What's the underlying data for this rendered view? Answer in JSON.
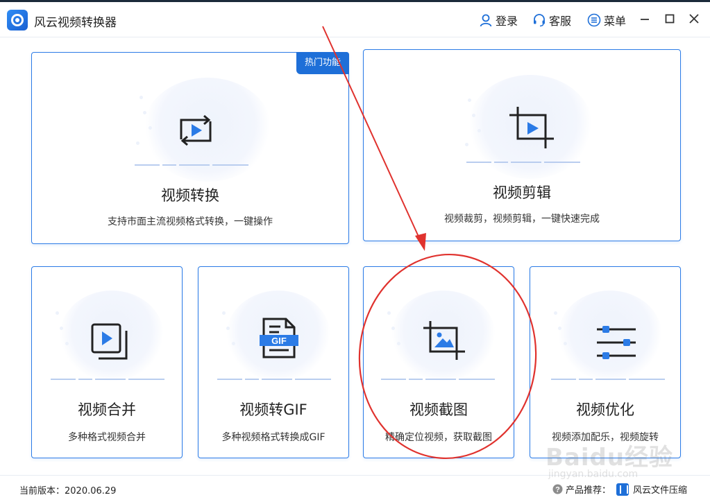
{
  "window": {
    "title": "风云视频转换器"
  },
  "toolbar": {
    "login_label": "登录",
    "service_label": "客服",
    "menu_label": "菜单"
  },
  "cards": {
    "convert": {
      "title": "视频转换",
      "desc": "支持市面主流视频格式转换，一键操作",
      "badge": "热门功能"
    },
    "edit": {
      "title": "视频剪辑",
      "desc": "视频裁剪，视频剪辑，一键快速完成"
    },
    "merge": {
      "title": "视频合并",
      "desc": "多种格式视频合并"
    },
    "gif": {
      "title": "视频转GIF",
      "desc": "多种视频格式转换成GIF",
      "icon_text": "GIF"
    },
    "screenshot": {
      "title": "视频截图",
      "desc": "精确定位视频，获取截图"
    },
    "optimize": {
      "title": "视频优化",
      "desc": "视频添加配乐，视频旋转"
    }
  },
  "status": {
    "version_label": "当前版本：2020.06.29",
    "recommend_label": "产品推荐：",
    "recommend_app": "风云文件压缩"
  },
  "watermark": {
    "brand": "Baidu经验",
    "url": "jingyan.baidu.com"
  },
  "colors": {
    "accent": "#2b7be6",
    "badge": "#1e6fd8",
    "annotation": "#e0322e"
  }
}
